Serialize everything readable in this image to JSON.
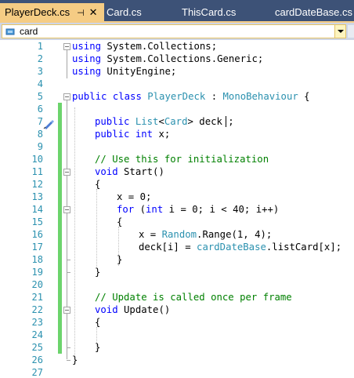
{
  "tabs": [
    {
      "label": "PlayerDeck.cs",
      "active": true
    },
    {
      "label": "Card.cs"
    },
    {
      "label": "ThisCard.cs"
    },
    {
      "label": "cardDateBase.cs"
    }
  ],
  "tab_glyphs": {
    "pin": "⊣",
    "close": "✕"
  },
  "navbar": {
    "member_value": "card"
  },
  "line_numbers": [
    "1",
    "2",
    "3",
    "4",
    "5",
    "6",
    "7",
    "8",
    "9",
    "10",
    "11",
    "12",
    "13",
    "14",
    "15",
    "16",
    "17",
    "18",
    "19",
    "20",
    "21",
    "22",
    "23",
    "24",
    "25",
    "26",
    "27"
  ],
  "code": {
    "l1": {
      "kw": "using",
      "rest": " System.Collections;"
    },
    "l2": {
      "kw": "using",
      "rest": " System.Collections.Generic;"
    },
    "l3": {
      "kw": "using",
      "rest": " UnityEngine;"
    },
    "l5": {
      "kw1": "public",
      "kw2": " class ",
      "type1": "PlayerDeck",
      "sep": " : ",
      "type2": "MonoBehaviour",
      "end": " {"
    },
    "l7": {
      "kw": "public",
      "sp": " ",
      "type1": "List",
      "lt": "<",
      "type2": "Card",
      "rest": "> deck ;"
    },
    "l8": {
      "kw1": "public",
      "kw2": " int",
      "rest": " x;"
    },
    "l10": {
      "comment": "// Use this for initialization"
    },
    "l11": {
      "kw": "void",
      "rest": " Start()"
    },
    "l12": {
      "text": "{"
    },
    "l13": {
      "text": "x = 0;"
    },
    "l14": {
      "kw1": "for",
      "p1": " (",
      "kw2": "int",
      "rest": " i = 0; i < 40; i++)"
    },
    "l15": {
      "text": "{"
    },
    "l16": {
      "pre": "x = ",
      "type": "Random",
      "rest": ".Range(1, 4);"
    },
    "l17": {
      "pre": "deck[i] = ",
      "type": "cardDateBase",
      "rest": ".listCard[x];"
    },
    "l18": {
      "text": "}"
    },
    "l19": {
      "text": "}"
    },
    "l21": {
      "comment": "// Update is called once per frame"
    },
    "l22": {
      "kw": "void",
      "rest": " Update()"
    },
    "l23": {
      "text": "{"
    },
    "l25": {
      "text": "}"
    },
    "l26": {
      "text": "}"
    }
  },
  "colors": {
    "tabbar": "#3d5277",
    "active_tab": "#f5cc84",
    "keyword": "#0000ff",
    "type": "#2b91af",
    "comment": "#008000",
    "change_bar": "#6cd46c"
  }
}
